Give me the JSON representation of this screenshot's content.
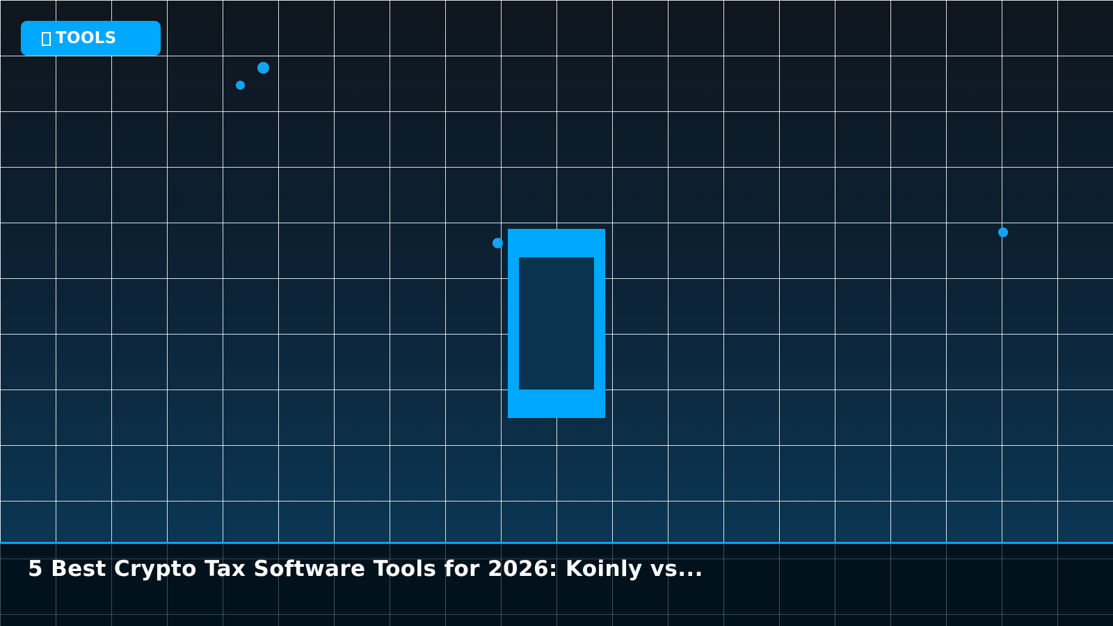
{
  "badge": {
    "icon": "phone-icon",
    "label": "TOOLS"
  },
  "illustration": {
    "icon": "smartphone-icon"
  },
  "footer": {
    "title": "5 Best Crypto Tax Software Tools for 2026: Koinly vs..."
  },
  "colors": {
    "accent": "#00a8ff",
    "background_top": "#0e161e",
    "background_bottom": "#0b3755",
    "footer_background": "#02101a",
    "text": "#ffffff"
  }
}
